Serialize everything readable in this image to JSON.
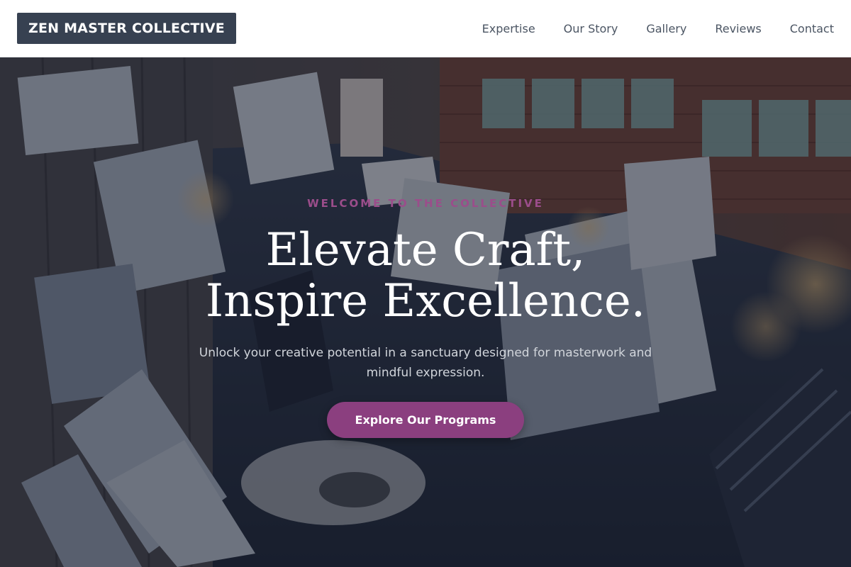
{
  "header": {
    "logo": "ZEN MASTER COLLECTIVE",
    "nav": [
      {
        "label": "Expertise"
      },
      {
        "label": "Our Story"
      },
      {
        "label": "Gallery"
      },
      {
        "label": "Reviews"
      },
      {
        "label": "Contact"
      }
    ]
  },
  "hero": {
    "eyebrow": "WELCOME TO THE COLLECTIVE",
    "headline_line1": "Elevate Craft,",
    "headline_line2": "Inspire Excellence.",
    "subtext": "Unlock your creative potential in a sanctuary designed for masterwork and mindful expression.",
    "cta_label": "Explore Our Programs",
    "background_image": "art-studio-photo"
  },
  "colors": {
    "header_bg": "#ffffff",
    "logo_bg": "#374151",
    "accent": "#8b3f7f",
    "eyebrow": "#9b4d8b",
    "nav_text": "#4b5563"
  }
}
